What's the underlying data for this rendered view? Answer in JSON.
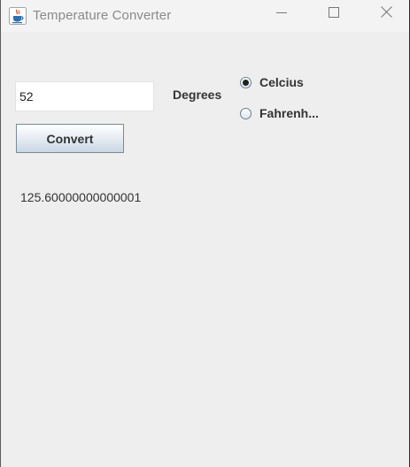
{
  "window": {
    "title": "Temperature Converter",
    "app_icon": "java-cup-icon",
    "controls": {
      "minimize_icon": "minimize-icon",
      "maximize_icon": "maximize-icon",
      "close_icon": "close-icon"
    }
  },
  "form": {
    "input_value": "52",
    "degrees_label": "Degrees",
    "convert_label": "Convert",
    "units": [
      {
        "label": "Celcius",
        "selected": true
      },
      {
        "label": "Fahrenh...",
        "selected": false
      }
    ],
    "result": "125.60000000000001"
  },
  "colors": {
    "window_bg": "#eeeeee",
    "titlebar_bg": "#f3f3f3",
    "title_text": "#8a8a8a",
    "label_text": "#333333"
  }
}
